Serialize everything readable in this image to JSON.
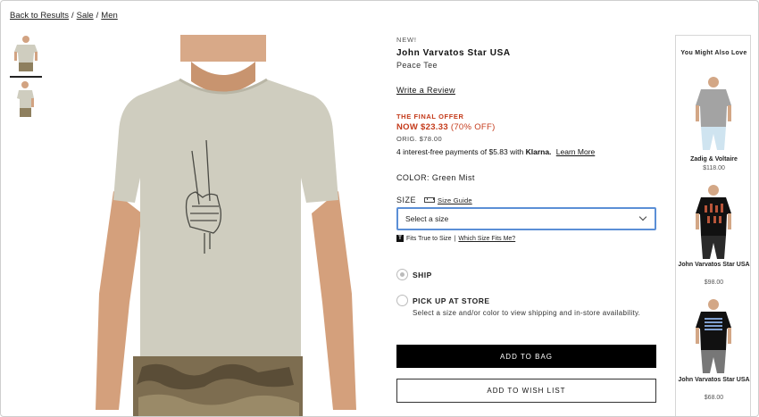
{
  "breadcrumb": {
    "back": "Back to Results",
    "sep1": "/",
    "sale": "Sale",
    "sep2": "/",
    "men": "Men"
  },
  "product": {
    "badge": "NEW!",
    "name": "John Varvatos Star USA",
    "subtitle": "Peace Tee",
    "review_link": "Write a Review",
    "offer_label": "THE FINAL OFFER",
    "now_label": "NOW $23.33",
    "discount": "(70% OFF)",
    "orig_label": "ORIG. $78.00",
    "klarna_text": "4 interest-free payments of $5.83 with",
    "klarna_brand": "Klarna.",
    "klarna_link": "Learn More",
    "color_label": "COLOR:",
    "color_value": "Green Mist",
    "size_label": "SIZE",
    "size_guide": "Size Guide",
    "size_placeholder": "Select a size",
    "fit_icon": "T",
    "fit_text": "Fits True to Size",
    "fit_divider": "|",
    "fit_link": "Which Size Fits Me?",
    "ship_label": "SHIP",
    "pickup_label": "PICK UP AT STORE",
    "pickup_desc": "Select a size and/or color to view shipping and in-store availability.",
    "add_to_bag": "ADD TO BAG",
    "add_to_wishlist": "ADD TO WISH LIST"
  },
  "recommendations": {
    "title": "You Might Also Love",
    "items": [
      {
        "brand": "Zadig & Voltaire",
        "price": "$118.00"
      },
      {
        "brand": "John Varvatos Star USA",
        "price": "$98.00"
      },
      {
        "brand": "John Varvatos Star USA",
        "price": "$68.00"
      }
    ]
  },
  "colors": {
    "sale_red": "#c43a1a",
    "select_border": "#5b8fd6",
    "tee_green_mist": "#cfcdbf"
  },
  "icons": [
    "ruler-icon",
    "fit-icon",
    "chevron-down-icon",
    "radio-icon"
  ]
}
